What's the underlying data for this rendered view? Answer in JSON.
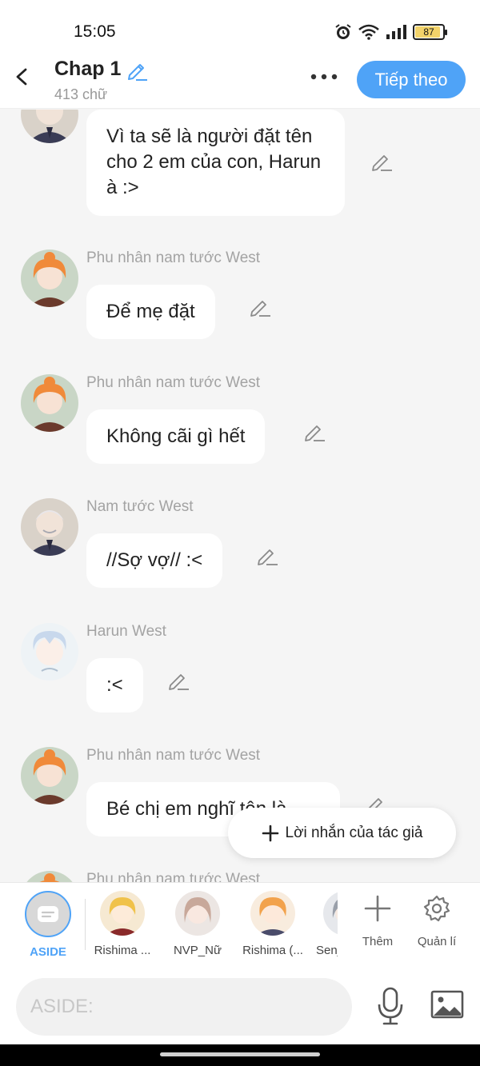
{
  "status": {
    "time": "15:05",
    "battery": "87"
  },
  "header": {
    "title": "Chap 1",
    "subtitle": "413 chữ",
    "next_label": "Tiếp theo"
  },
  "messages": [
    {
      "speaker": "",
      "text": "Vì ta sẽ là người đặt tên cho 2 em của con, Harun à :>",
      "avatar": "baron"
    },
    {
      "speaker": "Phu nhân nam tước West",
      "text": "Để mẹ đặt",
      "avatar": "baroness"
    },
    {
      "speaker": "Phu nhân nam tước West",
      "text": "Không cãi gì hết",
      "avatar": "baroness"
    },
    {
      "speaker": "Nam tước West",
      "text": "//Sợ vợ// :<",
      "avatar": "baron"
    },
    {
      "speaker": "Harun West",
      "text": ":<",
      "avatar": "harun"
    },
    {
      "speaker": "Phu nhân nam tước West",
      "text": "Bé chị em nghĩ tên là",
      "avatar": "baroness"
    },
    {
      "speaker": "Phu nhân nam tước West",
      "text": "",
      "avatar": "baroness"
    }
  ],
  "author_note": {
    "label": "Lời nhắn của tác giả"
  },
  "characters": {
    "aside_label": "ASIDE",
    "items": [
      {
        "name": "Rishima ...",
        "color": "#f0c24a"
      },
      {
        "name": "NVP_Nữ",
        "color": "#c8a89a"
      },
      {
        "name": "Rishima (...",
        "color": "#f2a24c"
      },
      {
        "name": "Senj",
        "color": "#9aa0aa"
      }
    ],
    "add_label": "Thêm",
    "manage_label": "Quản lí"
  },
  "input": {
    "placeholder": "ASIDE:"
  },
  "colors": {
    "accent": "#4fa3f7",
    "background": "#f5f5f5",
    "muted": "#a3a3a3"
  }
}
